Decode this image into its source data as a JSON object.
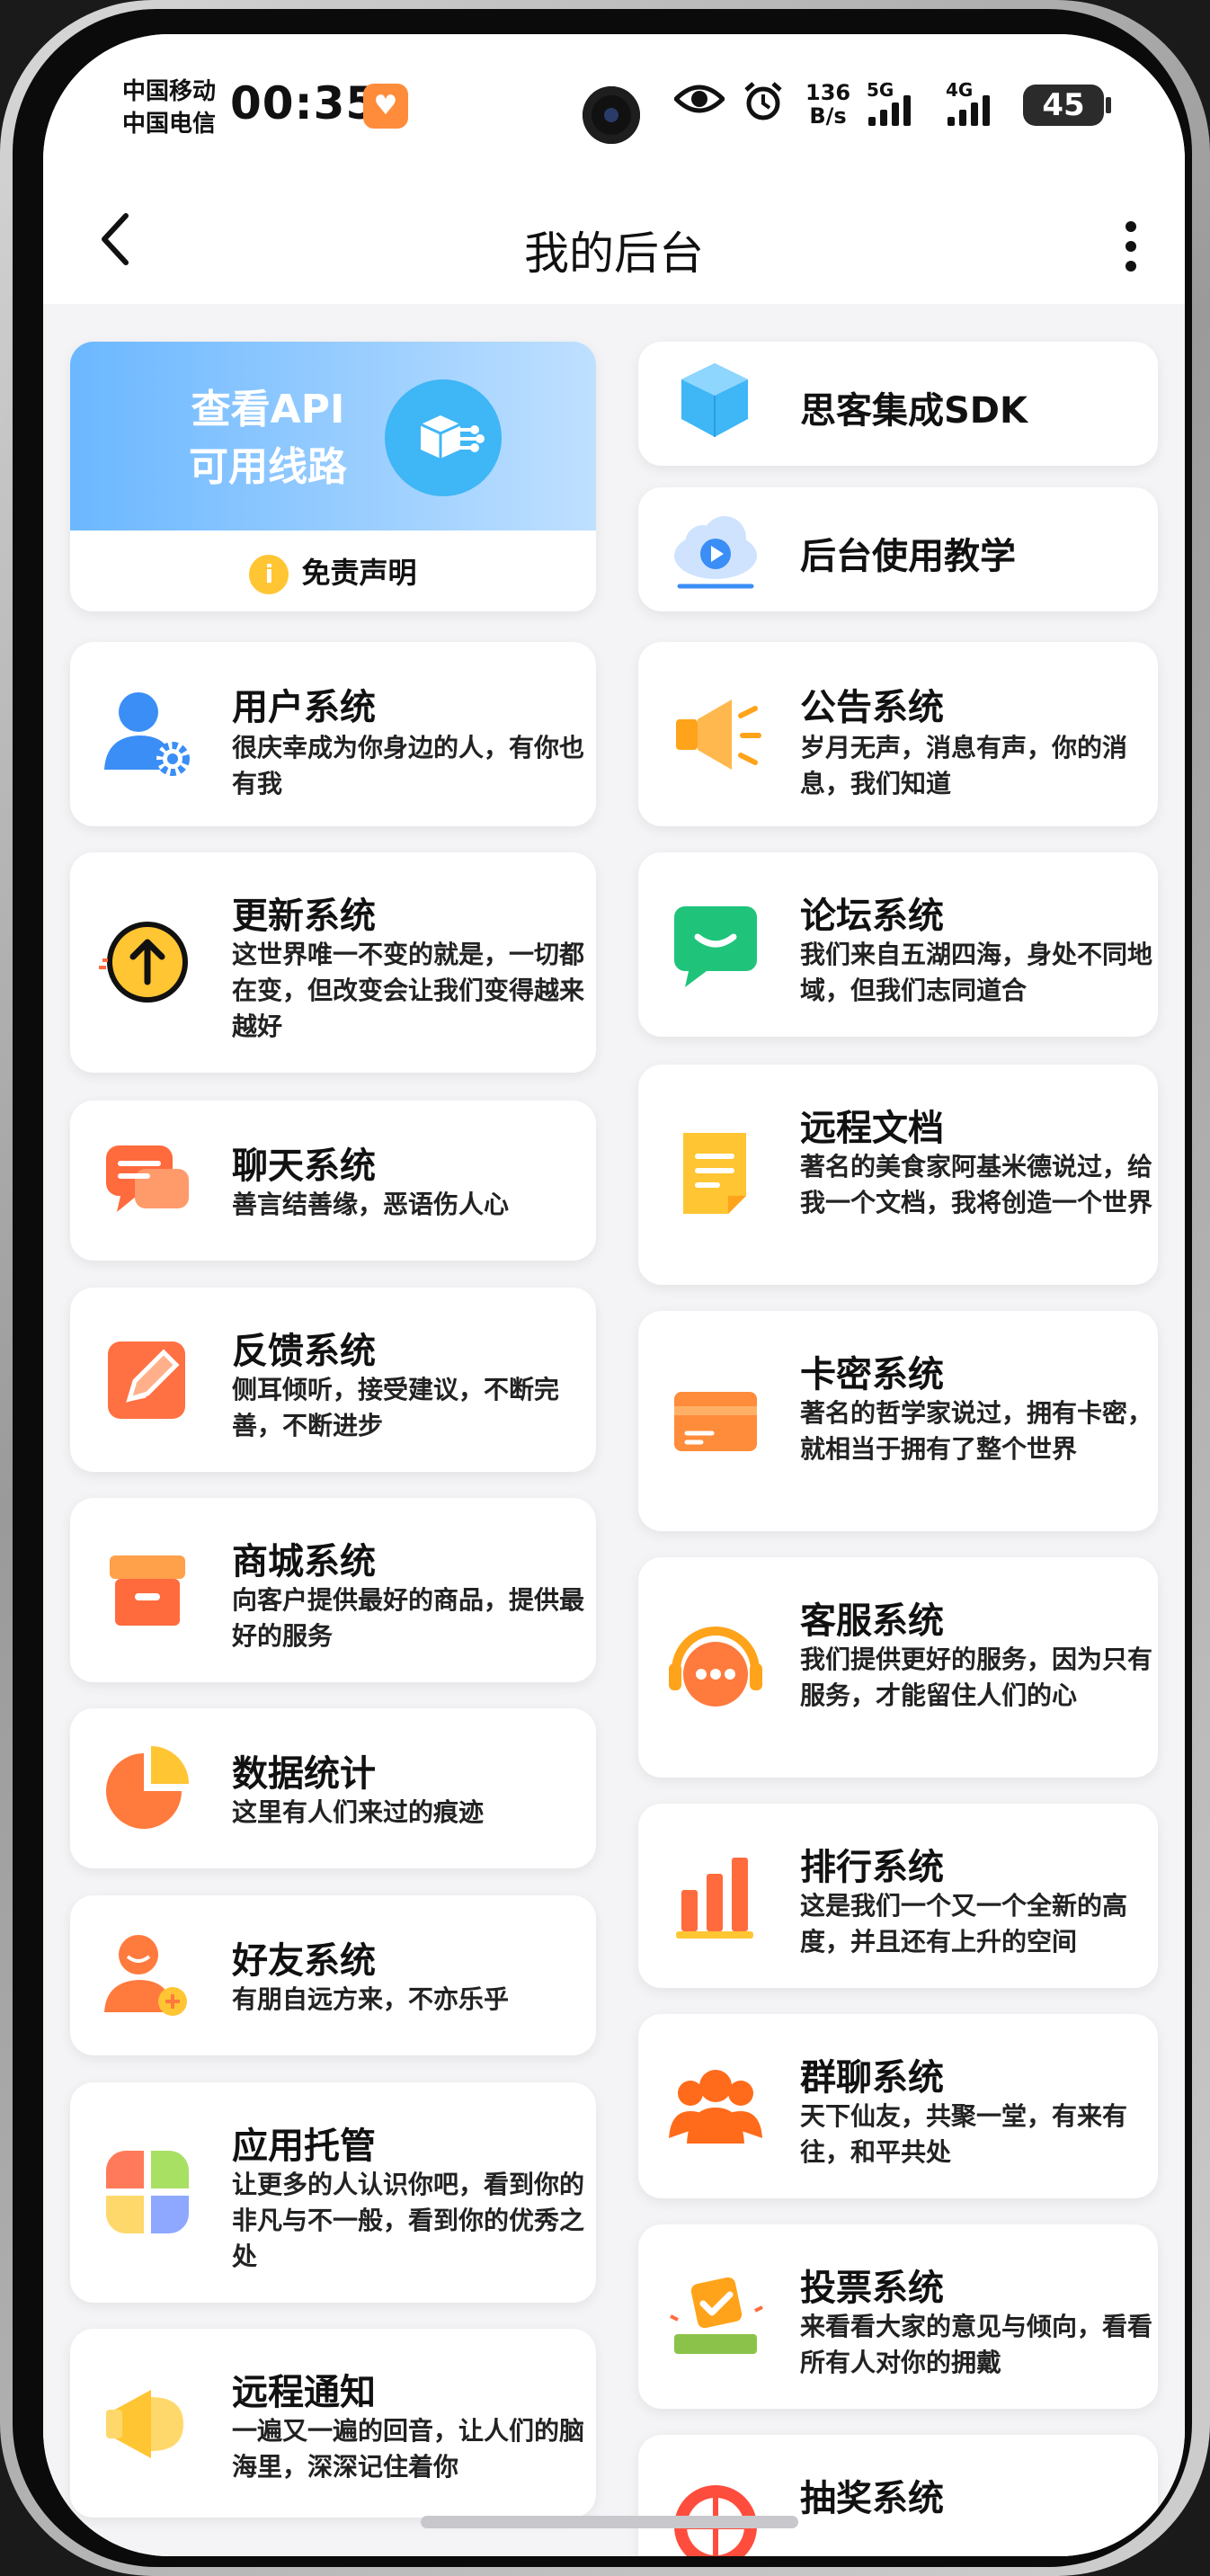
{
  "status": {
    "carrier1": "中国移动",
    "carrier2": "中国电信",
    "time": "00:35",
    "speed_value": "136",
    "speed_unit": "B/s",
    "net1": "5G",
    "net2": "4G",
    "battery": "45"
  },
  "nav": {
    "title": "我的后台"
  },
  "api_card": {
    "line1": "查看API",
    "line2": "可用线路",
    "disclaimer": "免责声明",
    "info_glyph": "i"
  },
  "left": [
    {
      "title": "用户系统",
      "desc": "很庆幸成为你身边的人，有你也有我",
      "icon": "user-settings-icon",
      "color": "#3a8ef6"
    },
    {
      "title": "更新系统",
      "desc": "这世界唯一不变的就是，一切都在变，但改变会让我们变得越来越好",
      "icon": "update-arrow-icon",
      "color": "#ffc533"
    },
    {
      "title": "聊天系统",
      "desc": "善言结善缘，恶语伤人心",
      "icon": "chat-bubble-icon",
      "color": "#ff6b3d"
    },
    {
      "title": "反馈系统",
      "desc": "侧耳倾听，接受建议，不断完善，不断进步",
      "icon": "feedback-pen-icon",
      "color": "#ff7043"
    },
    {
      "title": "商城系统",
      "desc": "向客户提供最好的商品，提供最好的服务",
      "icon": "store-box-icon",
      "color": "#ff6b3d"
    },
    {
      "title": "数据统计",
      "desc": "这里有人们来过的痕迹",
      "icon": "pie-chart-icon",
      "color": "#ff7a3d"
    },
    {
      "title": "好友系统",
      "desc": "有朋自远方来，不亦乐乎",
      "icon": "add-friend-icon",
      "color": "#ff7a3d"
    },
    {
      "title": "应用托管",
      "desc": "让更多的人认识你吧，看到你的非凡与不一般，看到你的优秀之处",
      "icon": "apps-grid-icon",
      "color": "#ff7a5a"
    },
    {
      "title": "远程通知",
      "desc": "一遍又一遍的回音，让人们的脑海里，深深记住着你",
      "icon": "megaphone-icon",
      "color": "#ffc533"
    }
  ],
  "right": [
    {
      "title": "思客集成SDK",
      "icon": "cube-icon",
      "color": "#3fb6f5"
    },
    {
      "title": "后台使用教学",
      "icon": "cloud-play-icon",
      "color": "#3a8ef6"
    },
    {
      "title": "公告系统",
      "desc": "岁月无声，消息有声，你的消息，我们知道",
      "icon": "announcement-icon",
      "color": "#ffa31a"
    },
    {
      "title": "论坛系统",
      "desc": "我们来自五湖四海，身处不同地域，但我们志同道合",
      "icon": "forum-chat-icon",
      "color": "#1fc47a"
    },
    {
      "title": "远程文档",
      "desc": "著名的美食家阿基米德说过，给我一个文档，我将创造一个世界",
      "icon": "document-icon",
      "color": "#ffc533"
    },
    {
      "title": "卡密系统",
      "desc": "著名的哲学家说过，拥有卡密，就相当于拥有了整个世界",
      "icon": "card-icon",
      "color": "#ff8c3a"
    },
    {
      "title": "客服系统",
      "desc": "我们提供更好的服务，因为只有服务，才能留住人们的心",
      "icon": "headset-icon",
      "color": "#ff7a3d"
    },
    {
      "title": "排行系统",
      "desc": "这是我们一个又一个全新的高度，并且还有上升的空间",
      "icon": "bar-rank-icon",
      "color": "#ff6b3d"
    },
    {
      "title": "群聊系统",
      "desc": "天下仙友，共聚一堂，有来有往，和平共处",
      "icon": "group-icon",
      "color": "#ff6b1a"
    },
    {
      "title": "投票系统",
      "desc": "来看看大家的意见与倾向，看看所有人对你的拥戴",
      "icon": "vote-icon",
      "color": "#ffa31a"
    },
    {
      "title": "抽奖系统",
      "icon": "lottery-wheel-icon",
      "color": "#ff4d3d"
    }
  ]
}
